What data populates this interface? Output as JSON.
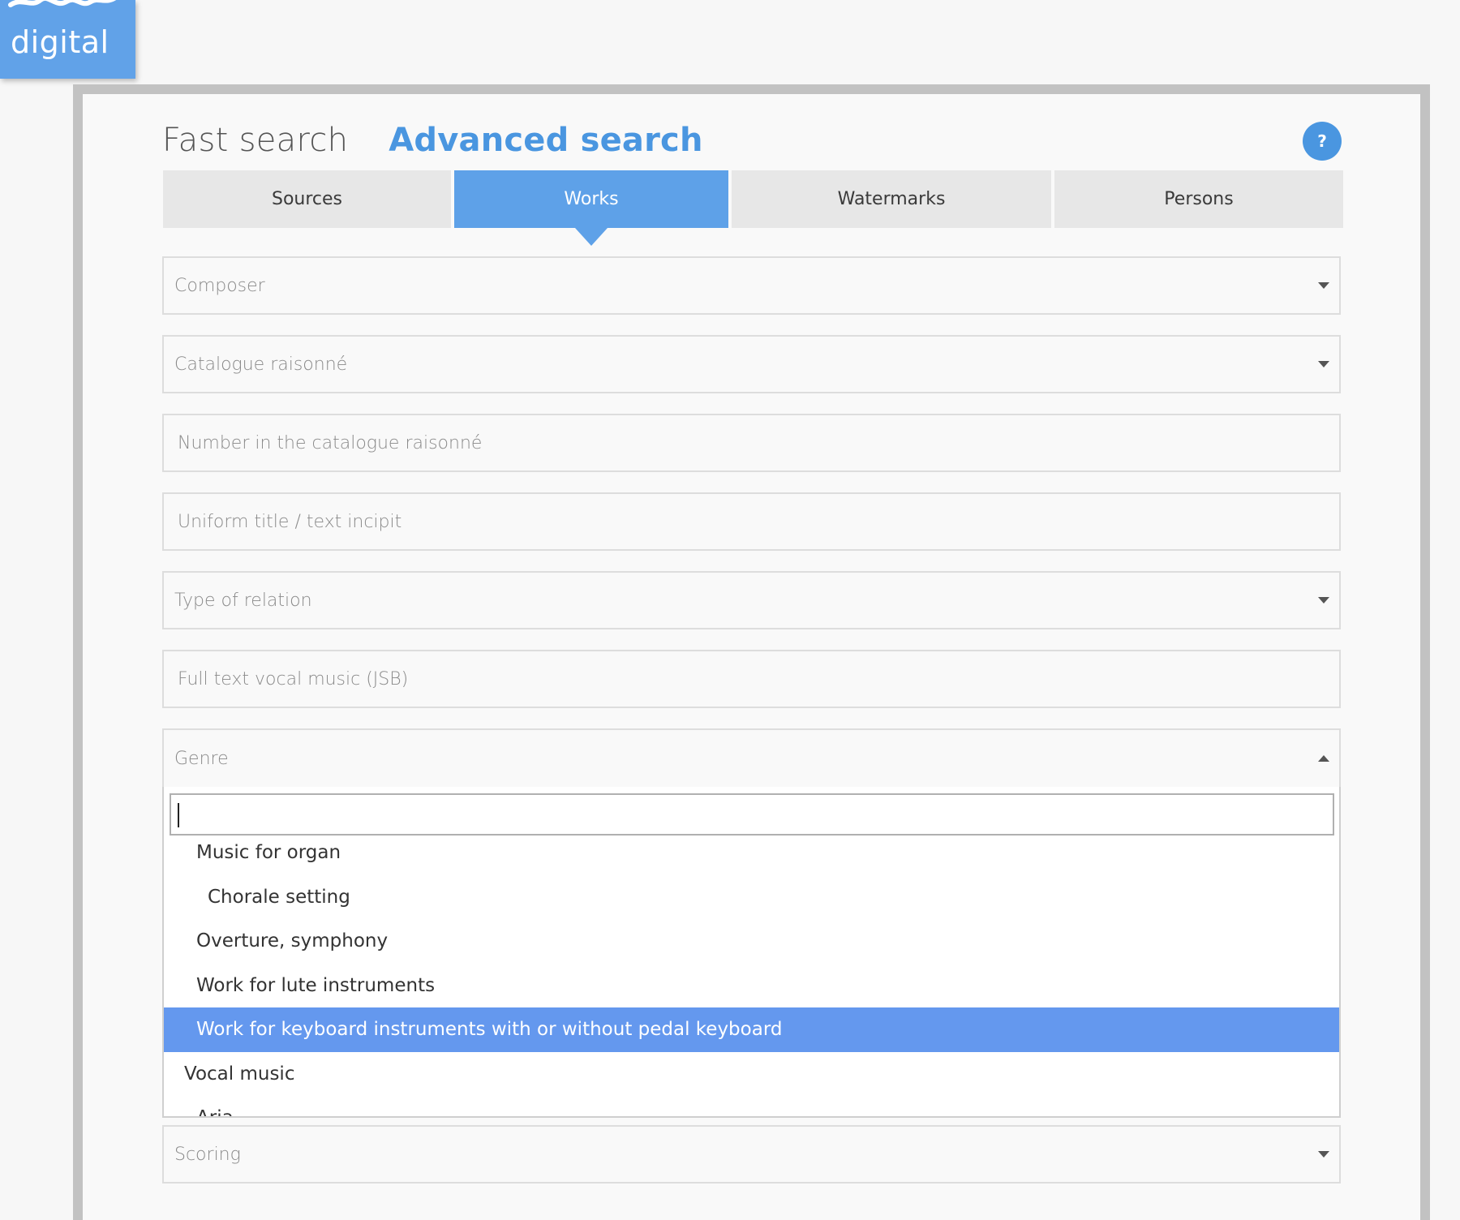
{
  "logo": {
    "text": "digital"
  },
  "search_mode": {
    "fast": "Fast search",
    "advanced": "Advanced search"
  },
  "help": {
    "label": "?"
  },
  "tabs": [
    {
      "label": "Sources",
      "active": false
    },
    {
      "label": "Works",
      "active": true
    },
    {
      "label": "Watermarks",
      "active": false
    },
    {
      "label": "Persons",
      "active": false
    }
  ],
  "fields": {
    "composer": "Composer",
    "catalogue": "Catalogue raisonné",
    "catalogue_number": "Number in the catalogue raisonné",
    "uniform_title": "Uniform title / text incipit",
    "relation_type": "Type of relation",
    "full_text": "Full text vocal music (JSB)",
    "genre": "Genre",
    "scoring": "Scoring"
  },
  "genre_dropdown": {
    "search_value": "",
    "items": [
      {
        "label": "Music for organ",
        "level": 1,
        "selected": false
      },
      {
        "label": "Chorale setting",
        "level": 2,
        "selected": false
      },
      {
        "label": "Overture, symphony",
        "level": 1,
        "selected": false
      },
      {
        "label": "Work for lute instruments",
        "level": 1,
        "selected": false
      },
      {
        "label": "Work for keyboard instruments with or without pedal keyboard",
        "level": 1,
        "selected": true
      },
      {
        "label": "Vocal music",
        "level": 0,
        "selected": false
      },
      {
        "label": "Aria",
        "level": 1,
        "selected": false
      }
    ]
  },
  "colors": {
    "accent": "#4a96e0",
    "tab_active": "#5ea1e8",
    "selected_option": "#6498ee",
    "logo_bg": "#61a2e8"
  }
}
